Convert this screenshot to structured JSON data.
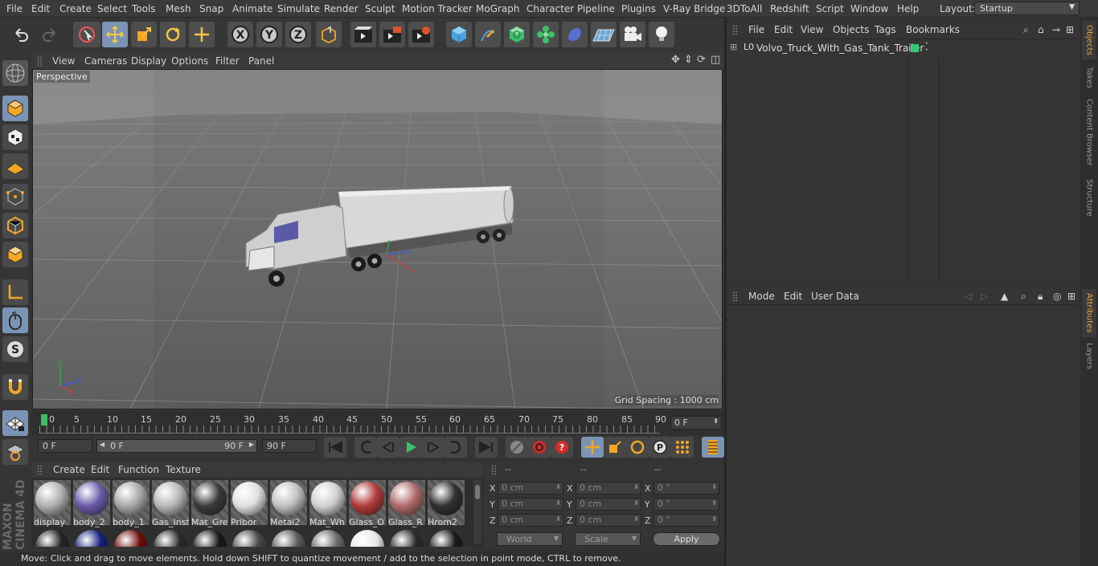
{
  "menubar": {
    "items": [
      "File",
      "Edit",
      "Create",
      "Select",
      "Tools",
      "Mesh",
      "Snap",
      "Animate",
      "Simulate",
      "Render",
      "Sculpt",
      "Motion Tracker",
      "MoGraph",
      "Character",
      "Pipeline",
      "Plugins",
      "V-Ray Bridge",
      "3DToAll",
      "Redshift",
      "Script",
      "Window",
      "Help"
    ],
    "layout_label": "Layout:",
    "layout_value": "Startup"
  },
  "toolbar": {
    "axis_x": "X",
    "axis_y": "Y",
    "axis_z": "Z",
    "icons": [
      "undo-icon",
      "redo-icon",
      "select-icon",
      "move-icon",
      "scale-icon",
      "rotate-icon",
      "live-select-icon",
      "x-axis-icon",
      "y-axis-icon",
      "z-axis-icon",
      "coordinate-system-icon",
      "render-view-icon",
      "render-picture-viewer-icon",
      "render-settings-icon",
      "cube-icon",
      "pen-icon",
      "subdivision-icon",
      "cloner-icon",
      "deformer-icon",
      "floor-icon",
      "camera-icon",
      "light-icon"
    ]
  },
  "viewport": {
    "menu": [
      "View",
      "Cameras",
      "Display",
      "Options",
      "Filter",
      "Panel"
    ],
    "label": "Perspective",
    "grid_spacing": "Grid Spacing : 1000 cm",
    "axis_x": "X",
    "axis_y": "Y",
    "axis_z": "Z"
  },
  "timeline": {
    "ticks": [
      "0",
      "5",
      "10",
      "15",
      "20",
      "25",
      "30",
      "35",
      "40",
      "45",
      "50",
      "55",
      "60",
      "65",
      "70",
      "75",
      "80",
      "85",
      "90"
    ],
    "current_frame": "0 F",
    "start_frame": "0 F",
    "range_start": "0 F",
    "range_end": "90 F",
    "end_frame": "90 F"
  },
  "materials": {
    "menu": [
      "Create",
      "Edit",
      "Function",
      "Texture"
    ],
    "items": [
      {
        "label": "display",
        "color": "#b0b0b0"
      },
      {
        "label": "body_2",
        "color": "#6a5aa8"
      },
      {
        "label": "body_1",
        "color": "#a8a8a8"
      },
      {
        "label": "Gas_Inst",
        "color": "#b8b8b8"
      },
      {
        "label": "Mat_Gre",
        "color": "#3a3a3a"
      },
      {
        "label": "Pribor",
        "color": "#e0e0e0"
      },
      {
        "label": "Metal2",
        "color": "#c0c0c0"
      },
      {
        "label": "Mat_Wh",
        "color": "#d0d0d0"
      },
      {
        "label": "Glass_O",
        "color": "#b03a3a"
      },
      {
        "label": "Glass_R",
        "color": "#b06a6a"
      },
      {
        "label": "Hrom2",
        "color": "#303030"
      }
    ],
    "row2_colors": [
      "#222",
      "#12207a",
      "#6a0a0a",
      "#2a2a2a",
      "#181818",
      "#4a4a4a",
      "#5a5a5a",
      "#6a6a6a",
      "#e8e8e8",
      "#2a2a2a",
      "#1a1a1a"
    ]
  },
  "coordinates": {
    "headers": [
      "--",
      "--",
      "--"
    ],
    "rows": [
      {
        "a": "X",
        "pos": "0 cm",
        "b": "X",
        "size": "0 cm",
        "c": "X",
        "rot": "0 °"
      },
      {
        "a": "Y",
        "pos": "0 cm",
        "b": "Y",
        "size": "0 cm",
        "c": "Y",
        "rot": "0 °"
      },
      {
        "a": "Z",
        "pos": "0 cm",
        "b": "Z",
        "size": "0 cm",
        "c": "Z",
        "rot": "0 °"
      }
    ],
    "mode": "World",
    "scale": "Scale",
    "apply": "Apply"
  },
  "status": "Move: Click and drag to move elements. Hold down SHIFT to quantize movement / add to the selection in point mode, CTRL to remove.",
  "object_manager": {
    "menu": [
      "File",
      "Edit",
      "View",
      "Objects",
      "Tags",
      "Bookmarks"
    ],
    "object_name": "Volvo_Truck_With_Gas_Tank_Trailer",
    "object_color": "#2ecc71"
  },
  "attribute_manager": {
    "menu": [
      "Mode",
      "Edit",
      "User Data"
    ]
  },
  "right_tabs": {
    "top": [
      "Objects",
      "Takes",
      "Content Browser",
      "Structure"
    ],
    "bottom": [
      "Attributes",
      "Layers"
    ]
  },
  "branding": {
    "logo_text": "MAXON CINEMA 4D"
  },
  "colors": {
    "accent": "#7b94b5",
    "active_tab": "#e8a53b"
  }
}
